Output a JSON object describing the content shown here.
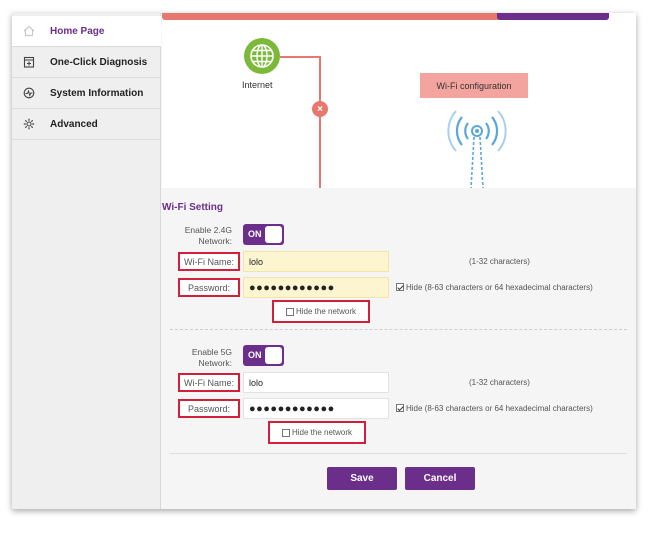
{
  "sidebar": {
    "items": [
      {
        "label": "Home Page",
        "icon": "home-icon",
        "active": true
      },
      {
        "label": "One-Click Diagnosis",
        "icon": "diagnosis-icon"
      },
      {
        "label": "System Information",
        "icon": "info-icon"
      },
      {
        "label": "Advanced",
        "icon": "gear-icon"
      }
    ]
  },
  "diagram": {
    "internet_label": "Internet",
    "wifi_config_label": "Wi-Fi configuration",
    "error_symbol": "×",
    "colors": {
      "error": "#e8786e",
      "brand": "#6b2e8a",
      "globe": "#7cb93b"
    }
  },
  "wifi_setting": {
    "title": "Wi-Fi Setting",
    "band_24": {
      "enable_label_1": "Enable 2.4G",
      "enable_label_2": "Network:",
      "toggle": "ON",
      "name_label": "Wi-Fi Name:",
      "name_value": "lolo",
      "name_hint": "(1-32 characters)",
      "password_label": "Password:",
      "password_value": "●●●●●●●●●●●●",
      "password_hint": "Hide (8-63 characters or 64 hexadecimal characters)",
      "hide_network_label": "Hide the network"
    },
    "band_5": {
      "enable_label_1": "Enable 5G",
      "enable_label_2": "Network:",
      "toggle": "ON",
      "name_label": "Wi-Fi Name:",
      "name_value": "lolo",
      "name_hint": "(1-32 characters)",
      "password_label": "Password:",
      "password_value": "●●●●●●●●●●●●",
      "password_hint": "Hide (8-63 characters or 64 hexadecimal characters)",
      "hide_network_label": "Hide the network"
    },
    "save_label": "Save",
    "cancel_label": "Cancel"
  }
}
